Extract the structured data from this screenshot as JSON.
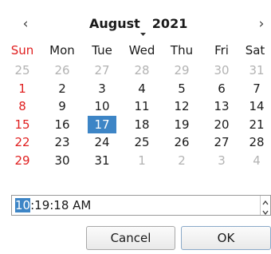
{
  "header": {
    "prev_glyph": "‹",
    "next_glyph": "›",
    "month": "August",
    "year": "2021"
  },
  "weekdays": [
    "Sun",
    "Mon",
    "Tue",
    "Wed",
    "Thu",
    "Fri",
    "Sat"
  ],
  "weeks": [
    [
      "25",
      "26",
      "27",
      "28",
      "29",
      "30",
      "31"
    ],
    [
      "1",
      "2",
      "3",
      "4",
      "5",
      "6",
      "7"
    ],
    [
      "8",
      "9",
      "10",
      "11",
      "12",
      "13",
      "14"
    ],
    [
      "15",
      "16",
      "17",
      "18",
      "19",
      "20",
      "21"
    ],
    [
      "22",
      "23",
      "24",
      "25",
      "26",
      "27",
      "28"
    ],
    [
      "29",
      "30",
      "31",
      "1",
      "2",
      "3",
      "4"
    ]
  ],
  "selected_day": "17",
  "time": {
    "hour": "10",
    "rest": ":19:18 AM"
  },
  "buttons": {
    "cancel": "Cancel",
    "ok": "OK"
  },
  "colors": {
    "sunday": "#e02020",
    "selection": "#3d85c6",
    "other_month": "#b3b3b3"
  },
  "icons": {
    "prev": "chevron-left-icon",
    "next": "chevron-right-icon",
    "month_dropdown": "dropdown-arrow-icon",
    "spin_up": "spinner-up-icon",
    "spin_down": "spinner-down-icon"
  }
}
